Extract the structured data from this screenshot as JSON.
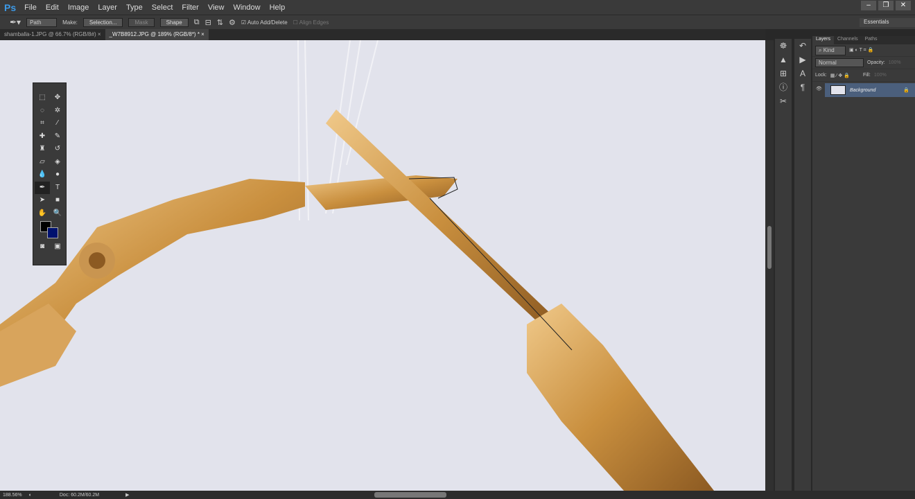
{
  "menubar": {
    "logo": "Ps",
    "items": [
      "File",
      "Edit",
      "Image",
      "Layer",
      "Type",
      "Select",
      "Filter",
      "View",
      "Window",
      "Help"
    ]
  },
  "options": {
    "mode": "Path",
    "make_label": "Make:",
    "selection": "Selection...",
    "mask": "Mask",
    "shape": "Shape",
    "auto_add_delete": "Auto Add/Delete",
    "align_edges": "Align Edges",
    "workspace": "Essentials"
  },
  "tabs": [
    {
      "label": "shamballa-1.JPG @ 66.7% (RGB/8#)",
      "close": "×"
    },
    {
      "label": "_W7B8912.JPG @ 189% (RGB/8*) *",
      "close": "×"
    }
  ],
  "status": {
    "zoom": "188.56%",
    "doc": "Doc: 60.2M/60.2M"
  },
  "layers_panel": {
    "tabs": [
      "Layers",
      "Channels",
      "Paths"
    ],
    "filter": "Kind",
    "blend": "Normal",
    "opacity_label": "Opacity:",
    "opacity": "100%",
    "lock_label": "Lock:",
    "fill_label": "Fill:",
    "fill": "100%",
    "layer_name": "Background"
  },
  "colors": {
    "foreground": "#000000",
    "background": "#00116e",
    "gold": "#d9a55a"
  }
}
